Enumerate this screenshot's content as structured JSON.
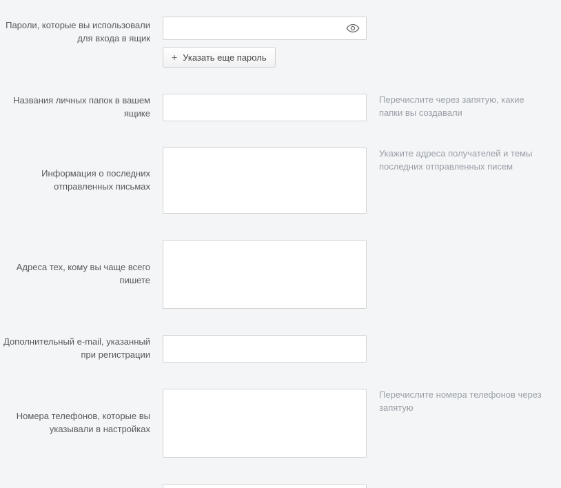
{
  "rows": {
    "password": {
      "label": "Пароли, которые вы использовали для входа в ящик",
      "value": "",
      "addButton": "Указать еще пароль"
    },
    "folders": {
      "label": "Названия личных папок в вашем ящике",
      "value": "",
      "hint": "Перечислите через запятую, какие папки вы создавали"
    },
    "sentInfo": {
      "label": "Информация о последних отправленных письмах",
      "value": "",
      "hint": "Укажите адреса получателей и темы последних отправленных писем"
    },
    "frequentAddresses": {
      "label": "Адреса тех, кому вы чаще всего пишете",
      "value": ""
    },
    "altEmail": {
      "label": "Дополнительный e-mail, указанный при регистрации",
      "value": ""
    },
    "phones": {
      "label": "Номера телефонов, которые вы указывали в настройках",
      "value": "",
      "hint": "Перечислите номера телефонов через запятую"
    }
  }
}
